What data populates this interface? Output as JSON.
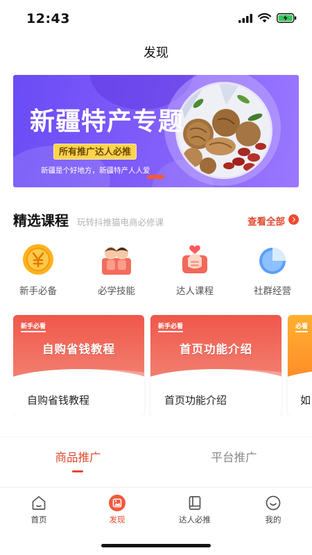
{
  "status_bar": {
    "time": "12:43"
  },
  "nav": {
    "title": "发现"
  },
  "banner": {
    "title": "新疆特产专题",
    "pill": "所有推广达人必推",
    "subtitle": "新疆是个好地方，新疆特产人人爱"
  },
  "courses_section": {
    "title": "精选课程",
    "subtitle": "玩转抖推猫电商必修课",
    "more": "查看全部"
  },
  "categories": [
    {
      "label": "新手必备",
      "icon": "coin-icon"
    },
    {
      "label": "必学技能",
      "icon": "people-icon"
    },
    {
      "label": "达人课程",
      "icon": "heart-hand-icon"
    },
    {
      "label": "社群经营",
      "icon": "pie-chart-icon"
    }
  ],
  "course_cards": [
    {
      "tag": "新手必看",
      "thumb_title": "自购省钱教程",
      "label": "自购省钱教程"
    },
    {
      "tag": "新手必看",
      "thumb_title": "首页功能介绍",
      "label": "首页功能介绍"
    },
    {
      "tag": "必看",
      "thumb_title": "",
      "label": "如"
    }
  ],
  "tabs": [
    {
      "label": "商品推广",
      "active": true
    },
    {
      "label": "平台推广",
      "active": false
    }
  ],
  "tabbar": [
    {
      "label": "首页",
      "icon": "home-icon",
      "active": false
    },
    {
      "label": "发现",
      "icon": "discover-icon",
      "active": true
    },
    {
      "label": "达人必推",
      "icon": "book-icon",
      "active": false
    },
    {
      "label": "我的",
      "icon": "smile-icon",
      "active": false
    }
  ],
  "colors": {
    "accent": "#e04a2e",
    "banner": "#7a57f8",
    "card_red": "#f0574b"
  }
}
